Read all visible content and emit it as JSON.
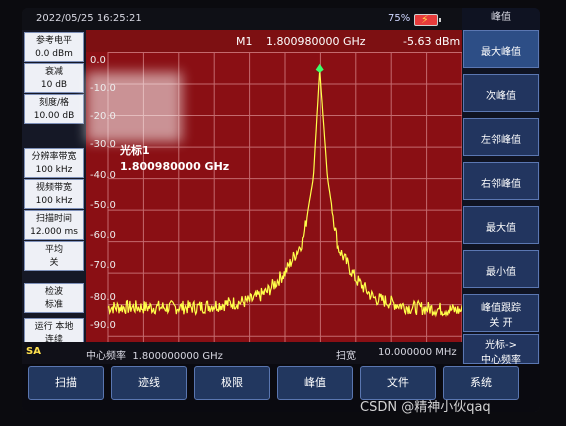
{
  "status": {
    "date_time": "2022/05/25   16:25:21",
    "battery": "75%"
  },
  "left_params": [
    {
      "name": "参考电平",
      "value": "0.0 dBm"
    },
    {
      "name": "衰减",
      "value": "10 dB"
    },
    {
      "name": "刻度/格",
      "value": "10.00 dB"
    },
    {
      "name": "分辨率带宽",
      "value": "100 kHz"
    },
    {
      "name": "视频带宽",
      "value": "100 kHz"
    },
    {
      "name": "扫描时间",
      "value": "12.000 ms"
    },
    {
      "name": "平均",
      "value": "关"
    },
    {
      "name": "检波",
      "value": "标准"
    },
    {
      "name": "运行  本地",
      "value": "连续"
    }
  ],
  "marker_header": {
    "id": "M1",
    "frequency": "1.800980000 GHz",
    "amplitude": "-5.63 dBm"
  },
  "marker_label": {
    "name": "光标1",
    "frequency": "1.800980000 GHz"
  },
  "y_axis": {
    "labels": [
      "0.0",
      "-10.0",
      "-20.0",
      "-30.0",
      "-40.0",
      "-50.0",
      "-60.0",
      "-70.0",
      "-80.0",
      "-90.0"
    ]
  },
  "mode": "SA",
  "bottom_info": {
    "center_freq_label": "中心频率",
    "center_freq": "1.800000000 GHz",
    "span_label": "扫宽",
    "span": "10.000000 MHz"
  },
  "right_menu": {
    "title": "峰值",
    "buttons": [
      {
        "label": "最大峰值"
      },
      {
        "label": "次峰值"
      },
      {
        "label": "左邻峰值"
      },
      {
        "label": "右邻峰值"
      },
      {
        "label": "最大值"
      },
      {
        "label": "最小值"
      },
      {
        "label": "峰值跟踪",
        "options": "关      开"
      },
      {
        "label": "光标->",
        "sub": "中心频率"
      }
    ]
  },
  "softkeys": [
    "扫描",
    "迹线",
    "极限",
    "峰值",
    "文件",
    "系统"
  ],
  "watermark": "CSDN @精神小伙qaq",
  "chart_data": {
    "type": "line",
    "title": "",
    "xlabel": "",
    "ylabel": "",
    "x_units": "GHz",
    "x": [
      1.795,
      1.7975,
      1.799,
      1.7995,
      1.8,
      1.8005,
      1.8008,
      1.80098,
      1.8012,
      1.8015,
      1.802,
      1.8025,
      1.8035,
      1.805
    ],
    "y": [
      -81,
      -81,
      -79,
      -76,
      -70,
      -60,
      -40,
      -5.63,
      -40,
      -62,
      -72,
      -78,
      -81,
      -82
    ],
    "ylim": [
      -92,
      0
    ],
    "xlim": [
      1.795,
      1.805
    ],
    "grid": true,
    "colors": {
      "trace": "#ffff4a",
      "background": "#8a0f14",
      "grid": "#c46a6e"
    }
  }
}
